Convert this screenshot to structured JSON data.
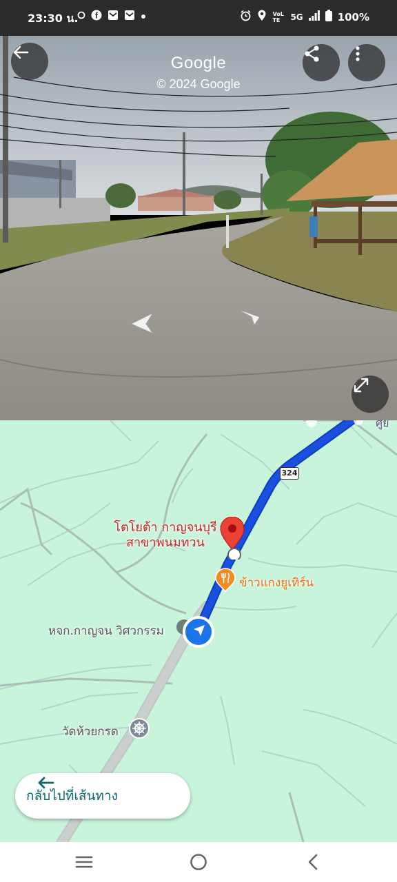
{
  "status_bar": {
    "time": "23:30 น.",
    "network": "5G",
    "volte": "VoLTE",
    "battery": "100%",
    "icons": [
      "circle-icon",
      "facebook-icon",
      "mail-icon",
      "mail-icon",
      "dot-icon",
      "alarm-icon",
      "location-icon",
      "signal-icon",
      "battery-icon"
    ]
  },
  "street_view": {
    "title": "Google",
    "copyright": "© 2024 Google",
    "buttons": [
      "back-arrow-icon",
      "share-icon",
      "more-vert-icon",
      "fullscreen-icon"
    ]
  },
  "map": {
    "route_number": "324",
    "destination_name": "โตโยต้า กาญจนบุรี สาขาพนมทวน",
    "restaurant_name": "ข้าวแกงยูเทิร์น",
    "company_name": "หจก.กาญจน วิศวกรรม",
    "temple_name": "วัดห้วยกรด",
    "partial_label": "ศูย",
    "back_to_route_label": "กลับไปที่เส้นทาง",
    "route_color": "#1a4fe0",
    "destination_pin_color": "#ea4335",
    "restaurant_icon_color": "#f28b22",
    "map_bg_color": "#c9f4dc"
  },
  "nav_bar": {
    "buttons": [
      "recents-icon",
      "home-icon",
      "back-icon"
    ]
  }
}
